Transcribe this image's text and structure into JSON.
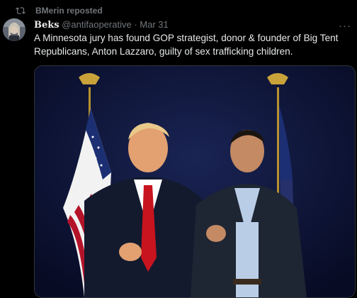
{
  "repost": {
    "label": "BMerin reposted",
    "icon": "repost-icon"
  },
  "tweet": {
    "display_name": "Beks",
    "handle": "@antifaoperative",
    "separator": "·",
    "date": "Mar 31",
    "more_icon": "more-icon",
    "text": "A Minnesota jury has found GOP strategist, donor & founder of Big Tent Republicans, Anton Lazzaro, guilty of sex trafficking children."
  },
  "media": {
    "description_icon": "photo"
  },
  "colors": {
    "background": "#000000",
    "text": "#e7e9ea",
    "muted": "#71767b",
    "border": "#2f3336",
    "photo_backdrop": "#0b1236"
  }
}
